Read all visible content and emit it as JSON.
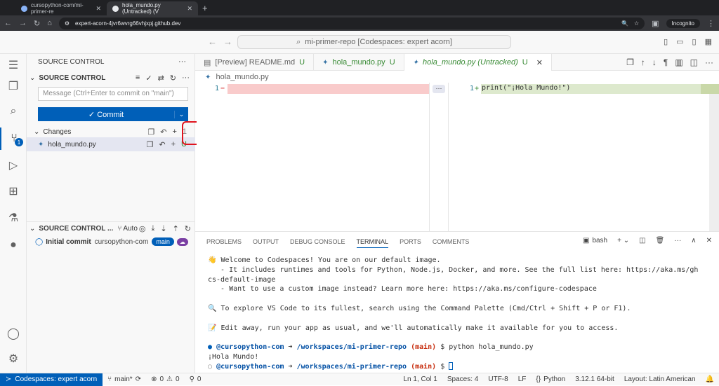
{
  "browser": {
    "tabs": [
      {
        "label": "cursopython-com/mi-primer-re"
      },
      {
        "label": "hola_mundo.py (Untracked) (V"
      }
    ],
    "url": "expert-acorn-4jvr6wvrg66vhjxpj.github.dev",
    "incognito": "Incognito"
  },
  "titlebar": {
    "command_center": "mi-primer-repo [Codespaces: expert acorn]"
  },
  "sidebar": {
    "header": "SOURCE CONTROL",
    "section_title": "SOURCE CONTROL",
    "message_placeholder": "Message (Ctrl+Enter to commit on \"main\")",
    "commit_label": "Commit",
    "changes_label": "Changes",
    "changes_count": "1",
    "changed_file": "hola_mundo.py",
    "changed_status": "U",
    "graph_title": "SOURCE CONTROL ...",
    "graph_auto": "Auto",
    "commit_entry": "Initial commit",
    "commit_author": "cursopython-com",
    "branch_pill": "main"
  },
  "activity": {
    "badge": "1"
  },
  "editor": {
    "tabs": [
      {
        "label": "[Preview] README.md",
        "status": "U"
      },
      {
        "label": "hola_mundo.py",
        "status": "U"
      },
      {
        "label": "hola_mundo.py (Untracked)",
        "status": "U"
      }
    ],
    "breadcrumb": "hola_mundo.py",
    "left_line": "1",
    "left_marker": "−",
    "right_line": "1",
    "right_marker": "+",
    "right_code": "print(\"¡Hola Mundo!\")",
    "fold": "···"
  },
  "panel": {
    "tabs": [
      "PROBLEMS",
      "OUTPUT",
      "DEBUG CONSOLE",
      "TERMINAL",
      "PORTS",
      "COMMENTS"
    ],
    "shell": "bash",
    "terminal": {
      "l1": "👋 Welcome to Codespaces! You are on our default image.",
      "l2": "   - It includes runtimes and tools for Python, Node.js, Docker, and more. See the full list here: https://aka.ms/gh",
      "l3": "cs-default-image",
      "l4": "   - Want to use a custom image instead? Learn more here: https://aka.ms/configure-codespace",
      "l5": "🔍 To explore VS Code to its fullest, search using the Command Palette (Cmd/Ctrl + Shift + P or F1).",
      "l6": "📝 Edit away, run your app as usual, and we'll automatically make it available for you to access.",
      "user": "@cursopython-com",
      "arrow": "➜",
      "path": "/workspaces/mi-primer-repo",
      "branch": "(main)",
      "cmd": "$ python hola_mundo.py",
      "output": "¡Hola Mundo!",
      "prompt_end": "$"
    }
  },
  "status": {
    "remote": "Codespaces: expert acorn",
    "branch": "main*",
    "errors": "0",
    "warnings": "0",
    "ports": "0",
    "position": "Ln 1, Col 1",
    "spaces": "Spaces: 4",
    "encoding": "UTF-8",
    "eol": "LF",
    "language": "Python",
    "interpreter": "3.12.1 64-bit",
    "layout": "Layout: Latin American"
  }
}
